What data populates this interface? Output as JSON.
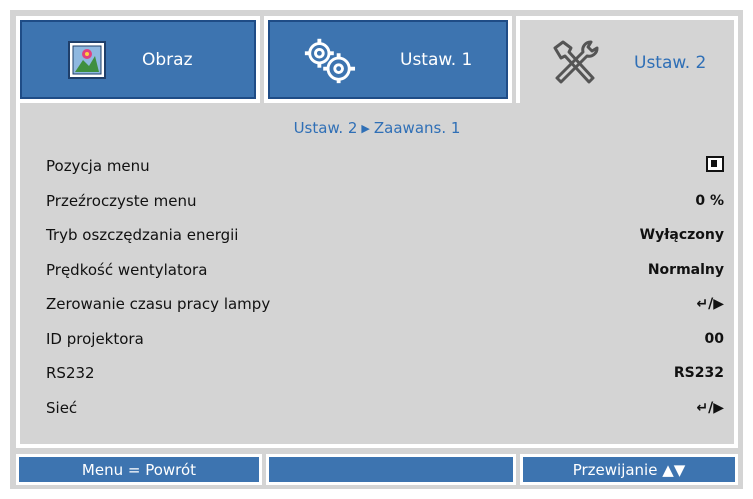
{
  "tabs": [
    {
      "label": "Obraz",
      "icon": "picture-icon",
      "active": false
    },
    {
      "label": "Ustaw. 1",
      "icon": "gears-icon",
      "active": false
    },
    {
      "label": "Ustaw. 2",
      "icon": "tools-icon",
      "active": true
    }
  ],
  "breadcrumb": {
    "parent": "Ustaw. 2",
    "separator_icon": "right-triangle-icon",
    "current": "Zaawans. 1"
  },
  "menu": [
    {
      "label": "Pozycja menu",
      "value": "",
      "value_icon": "menu-position-icon"
    },
    {
      "label": "Przeźroczyste menu",
      "value": "0 %"
    },
    {
      "label": "Tryb oszczędzania energii",
      "value": "Wyłączony"
    },
    {
      "label": "Prędkość wentylatora",
      "value": "Normalny"
    },
    {
      "label": "Zerowanie czasu pracy lampy",
      "value": "↵/▶",
      "value_icon": "enter-arrow-icon"
    },
    {
      "label": "ID projektora",
      "value": "00"
    },
    {
      "label": "RS232",
      "value": "RS232"
    },
    {
      "label": "Sieć",
      "value": "↵/▶",
      "value_icon": "enter-arrow-icon"
    }
  ],
  "footer": {
    "left": "Menu = Powrót",
    "middle": "",
    "right": "Przewijanie ▲▼"
  },
  "colors": {
    "tab_blue": "#3d74b0",
    "panel_gray": "#d4d4d4",
    "accent_text": "#2f6fb6"
  }
}
